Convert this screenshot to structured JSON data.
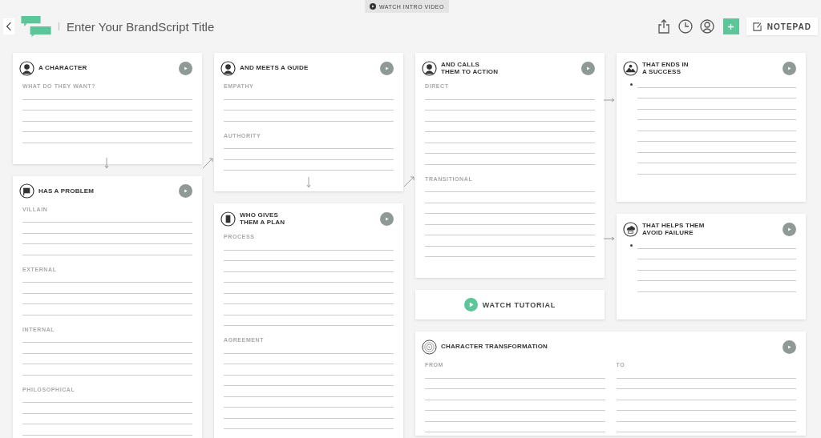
{
  "header": {
    "title": "Enter Your BrandScript Title",
    "intro_button": "WATCH INTRO VIDEO",
    "notepad_button": "NOTEPAD"
  },
  "cards": [
    {
      "title": "A CHARACTER",
      "sections": [
        {
          "kind": "labeled",
          "label": "WHAT DO THEY WANT?"
        }
      ]
    },
    {
      "title": "HAS A PROBLEM",
      "sections": [
        {
          "kind": "labeled",
          "label": "VILLAIN"
        },
        {
          "kind": "labeled",
          "label": "EXTERNAL"
        },
        {
          "kind": "labeled",
          "label": "INTERNAL"
        },
        {
          "kind": "labeled",
          "label": "PHILOSOPHICAL"
        }
      ]
    },
    {
      "title": "AND MEETS A GUIDE",
      "sections": [
        {
          "kind": "labeled",
          "label": "EMPATHY"
        },
        {
          "kind": "labeled",
          "label": "AUTHORITY"
        }
      ]
    },
    {
      "title": "WHO GIVES\nTHEM A PLAN",
      "sections": [
        {
          "kind": "labeled",
          "label": "PROCESS"
        },
        {
          "kind": "labeled",
          "label": "AGREEMENT"
        }
      ]
    },
    {
      "title": "AND CALLS\nTHEM TO ACTION",
      "sections": [
        {
          "kind": "labeled",
          "label": "DIRECT"
        },
        {
          "kind": "labeled",
          "label": "TRANSITIONAL"
        }
      ]
    },
    {
      "title": "THAT ENDS IN\nA SUCCESS",
      "sections": [
        {
          "kind": "bullet_list"
        }
      ]
    },
    {
      "title": "THAT HELPS THEM\nAVOID FAILURE",
      "sections": [
        {
          "kind": "bullet_list"
        }
      ]
    }
  ],
  "tutorial_button": "WATCH TUTORIAL",
  "transformation": {
    "title": "CHARACTER TRANSFORMATION",
    "columns": [
      {
        "label": "FROM"
      },
      {
        "label": "TO"
      }
    ]
  }
}
